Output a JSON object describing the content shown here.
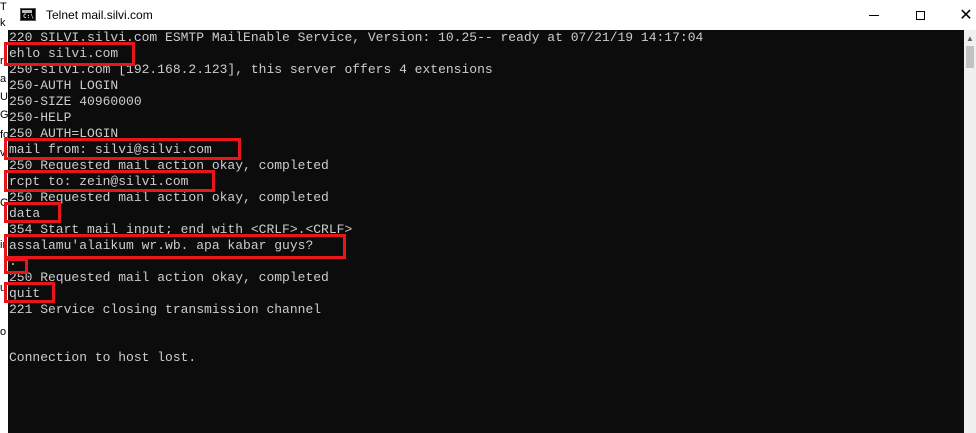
{
  "window": {
    "title": "Telnet mail.silvi.com",
    "icon": "console-icon",
    "icon_label": "C:\\",
    "controls": {
      "minimize": "minimize-icon",
      "maximize": "maximize-icon",
      "close": "close-icon"
    }
  },
  "behind_window_fragments": [
    "T",
    "k",
    "r",
    "a",
    "U",
    "G",
    "fo",
    "vi",
    "G",
    "ir",
    "u",
    "o"
  ],
  "console": {
    "lines": [
      "220 SILVI.silvi.com ESMTP MailEnable Service, Version: 10.25-- ready at 07/21/19 14:17:04",
      "ehlo silvi.com",
      "250-silvi.com [192.168.2.123], this server offers 4 extensions",
      "250-AUTH LOGIN",
      "250-SIZE 40960000",
      "250-HELP",
      "250 AUTH=LOGIN",
      "mail from: silvi@silvi.com",
      "250 Requested mail action okay, completed",
      "rcpt to: zein@silvi.com",
      "250 Requested mail action okay, completed",
      "data",
      "354 Start mail input; end with <CRLF>.<CRLF>",
      "assalamu'alaikum wr.wb. apa kabar guys?",
      ".",
      "250 Requested mail action okay, completed",
      "quit",
      "221 Service closing transmission channel",
      "",
      "",
      "Connection to host lost."
    ]
  },
  "colors": {
    "console_bg": "#0c0c0c",
    "console_text": "#cccccc",
    "highlight": "#e8151b"
  }
}
